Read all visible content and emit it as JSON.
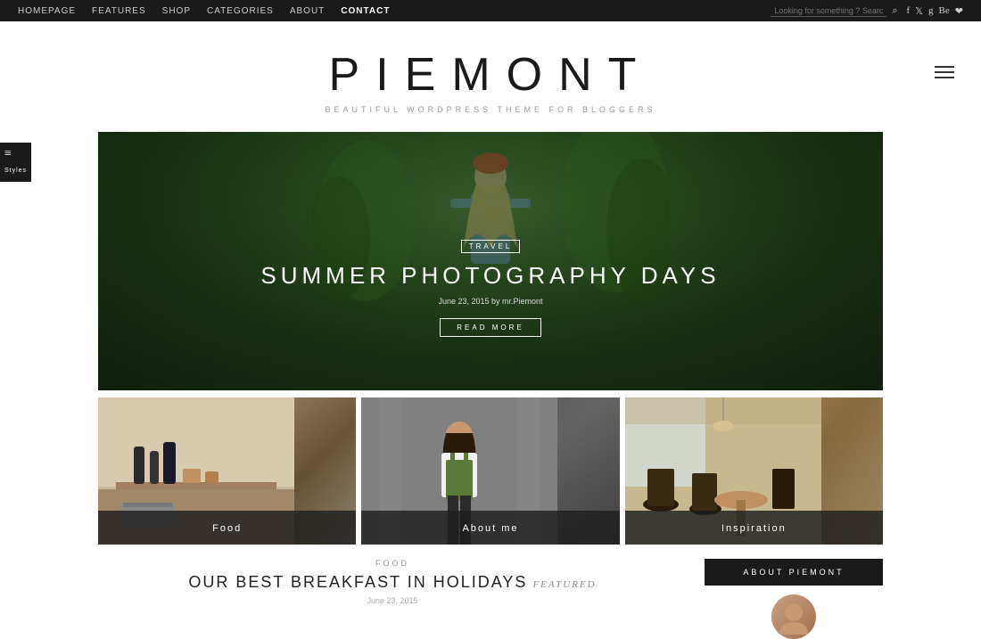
{
  "topnav": {
    "links": [
      {
        "label": "HOMEPAGE",
        "active": false
      },
      {
        "label": "FEATURES",
        "active": false
      },
      {
        "label": "SHOP",
        "active": false
      },
      {
        "label": "CATEGORIES",
        "active": false
      },
      {
        "label": "ABOUT",
        "active": false
      },
      {
        "label": "CONTACT",
        "active": true
      }
    ],
    "search_placeholder": "Looking for something ? Search away!",
    "social": [
      "f",
      "t",
      "g+",
      "be",
      "p"
    ]
  },
  "header": {
    "site_title": "PIEMONT",
    "site_tagline": "BEAUTIFUL  WORDPRESS THEME FOR BLOGGERS"
  },
  "styles_widget": {
    "label": "Styles"
  },
  "hero": {
    "category": "TRAVEL",
    "title": "SUMMER PHOTOGRAPHY DAYS",
    "meta": "June 23, 2015 by mr.Piemont",
    "read_more": "READ MORE"
  },
  "cards": [
    {
      "label": "Food"
    },
    {
      "label": "About me"
    },
    {
      "label": "Inspiration"
    }
  ],
  "bottom": {
    "post_category": "FOOD",
    "post_title": "OUR BEST BREAKFAST IN HOLIDAYS",
    "post_featured": "featured",
    "post_date": "June 23, 2015",
    "about_btn": "ABOUT PIEMONT"
  }
}
